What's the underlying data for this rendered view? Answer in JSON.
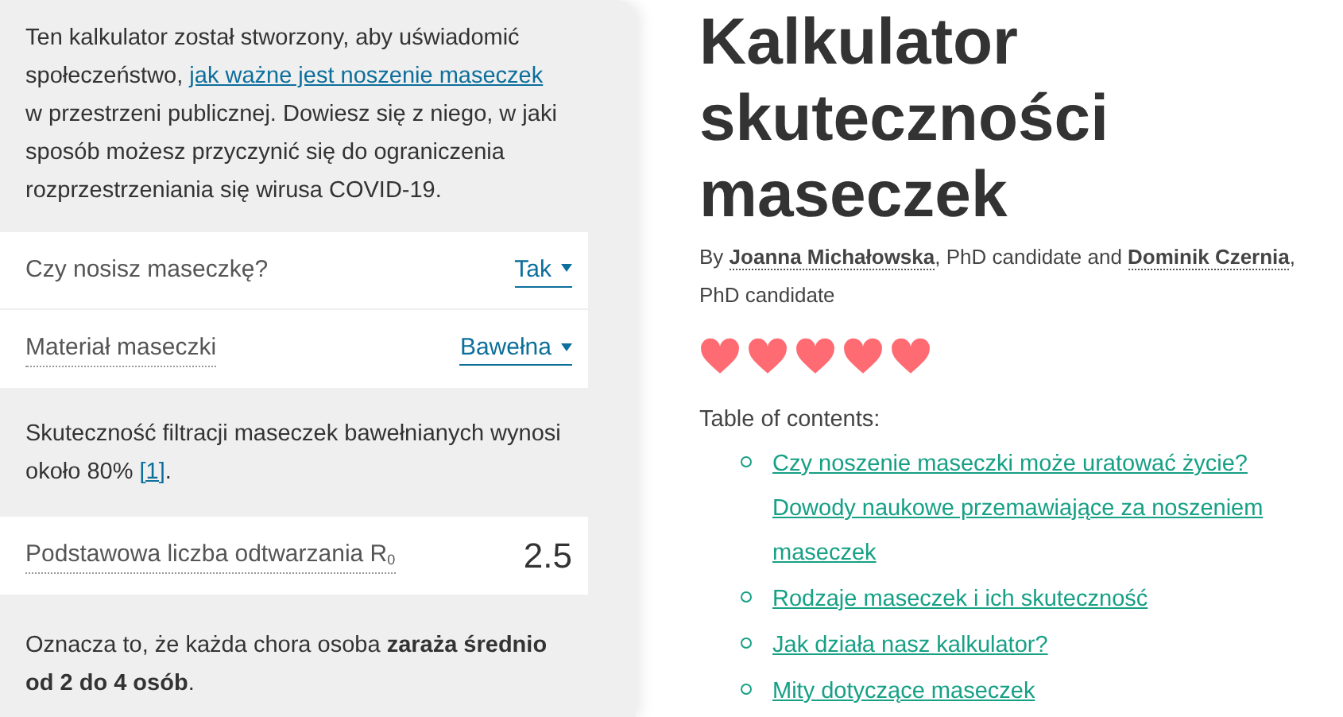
{
  "calculator": {
    "intro": {
      "before": "Ten kalkulator został stworzony, aby uświadomić społeczeństwo, ",
      "link": "jak ważne jest noszenie maseczek",
      "after": " w przestrzeni publicznej. Dowiesz się z niego, w jaki sposób możesz przyczynić się do ograniczenia rozprzestrzeniania się wirusa COVID-19."
    },
    "fields": [
      {
        "kind": "select",
        "label": "Czy nosisz maseczkę?",
        "value": "Tak",
        "dotted": false
      },
      {
        "kind": "select",
        "label": "Materiał maseczki",
        "value": "Bawełna",
        "dotted": true
      }
    ],
    "note": {
      "before": "Skuteczność filtracji maseczek bawełnianych wynosi około 80% ",
      "link": "[1]",
      "after": "."
    },
    "fields_2": [
      {
        "kind": "number",
        "label": "Podstawowa liczba odtwarzania R$_{0}$",
        "value": "2.5",
        "dotted": true
      }
    ],
    "result": "Oznacza to, że każda chora osoba **zaraża średnio od 2 do 4 osób**."
  },
  "article": {
    "title": "Kalkulator skuteczności maseczek",
    "byline": [
      {
        "kind": "text",
        "text": "By "
      },
      {
        "kind": "author",
        "text": "Joanna Michałowska"
      },
      {
        "kind": "text",
        "text": ", PhD candidate and "
      },
      {
        "kind": "author",
        "text": "Dominik Czernia"
      },
      {
        "kind": "text",
        "text": ", PhD candidate"
      }
    ],
    "rating": {
      "stars": 5
    },
    "toc_title": "Table of contents:",
    "toc": [
      "Czy noszenie maseczki może uratować życie? Dowody naukowe przemawiające za noszeniem maseczek",
      "Rodzaje maseczek i ich skuteczność",
      "Jak działa nasz kalkulator?",
      "Mity dotyczące maseczek"
    ]
  }
}
